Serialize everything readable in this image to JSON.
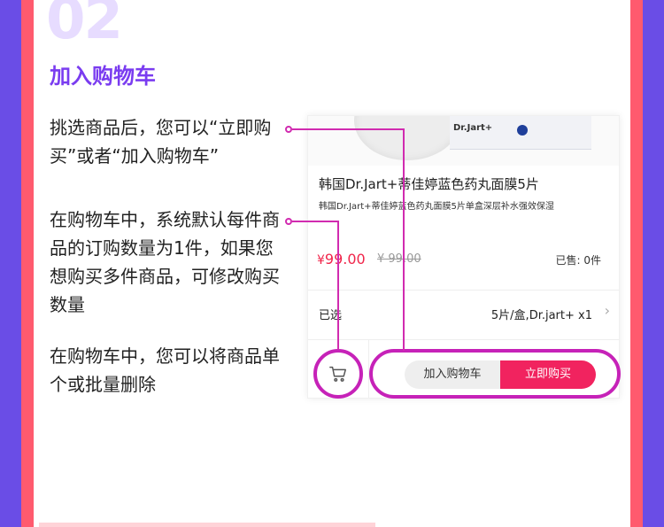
{
  "step": {
    "number": "02",
    "title": "加入购物车"
  },
  "descriptions": [
    "挑选商品后，您可以“立即购买”或者“加入购物车”",
    "在购物车中，系统默认每件商品的订购数量为1件，如果您想购买多件商品，可修改购买数量",
    "在购物车中，您可以将商品单个或批量删除"
  ],
  "product": {
    "box_brand": "Dr.Jart+",
    "title": "韩国Dr.Jart+蒂佳婷蓝色药丸面膜5片",
    "subtitle": "韩国Dr.Jart+蒂佳婷蓝色药丸面膜5片单盒深层补水强效保湿",
    "price_symbol": "¥",
    "price": "99.00",
    "old_price": "¥ 99.00",
    "sold": "已售: 0件"
  },
  "spec": {
    "label": "已选",
    "value": "5片/盒,Dr.jart+   x1",
    "chevron": "›"
  },
  "actions": {
    "cart_icon": "cart-icon",
    "add_to_cart": "加入购物车",
    "buy_now": "立即购买"
  },
  "colors": {
    "accent": "#7a3cf0",
    "highlight": "#c622b8",
    "price": "#f0254a",
    "buy_button": "#f1235f"
  }
}
